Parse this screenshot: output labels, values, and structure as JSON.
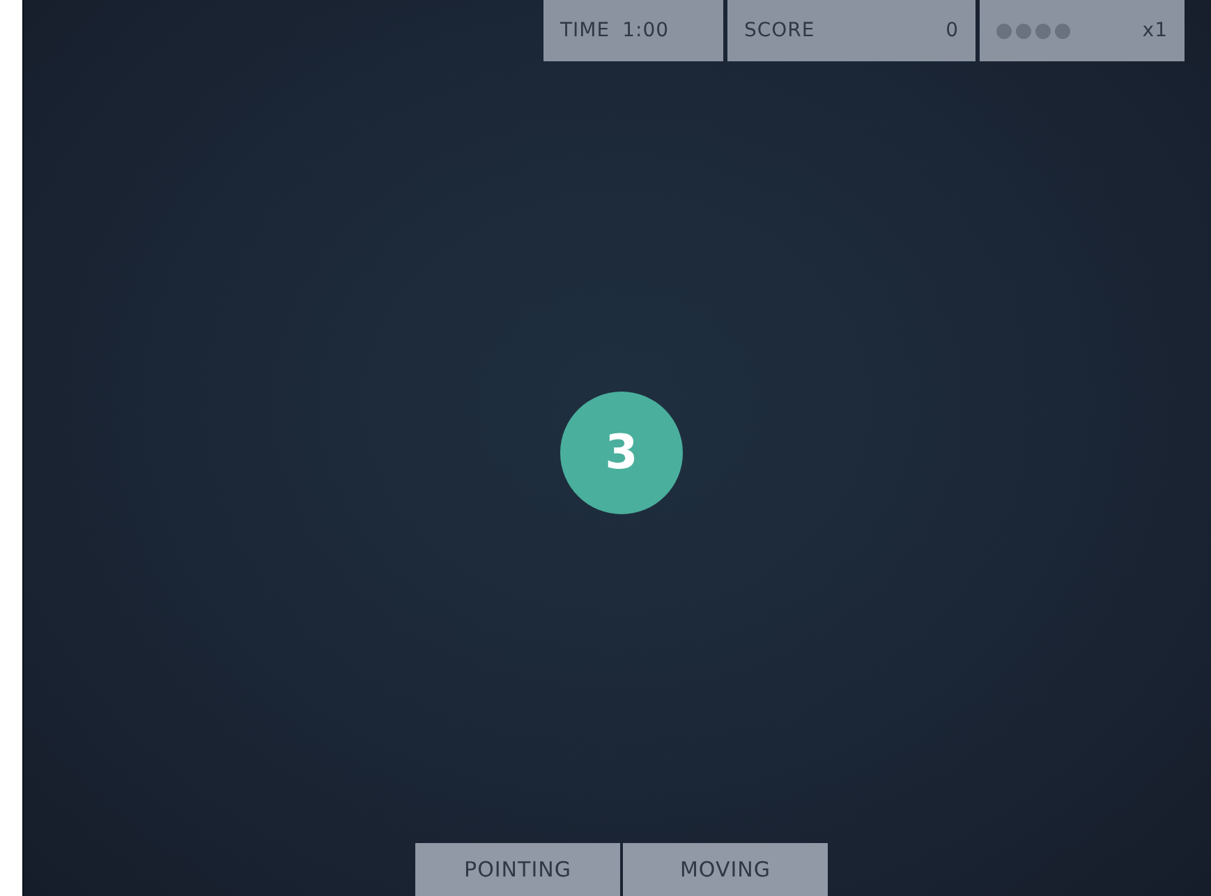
{
  "hud": {
    "time_label": "TIME",
    "time": "1:00",
    "score_label": "SCORE",
    "score": "0",
    "combo_dots": [
      {
        "filled": false
      },
      {
        "filled": false
      },
      {
        "filled": false
      },
      {
        "filled": false
      }
    ],
    "multiplier": "x1"
  },
  "countdown": "3",
  "modes": [
    {
      "label": "POINTING",
      "selected": false
    },
    {
      "label": "MOVING",
      "selected": false
    }
  ]
}
